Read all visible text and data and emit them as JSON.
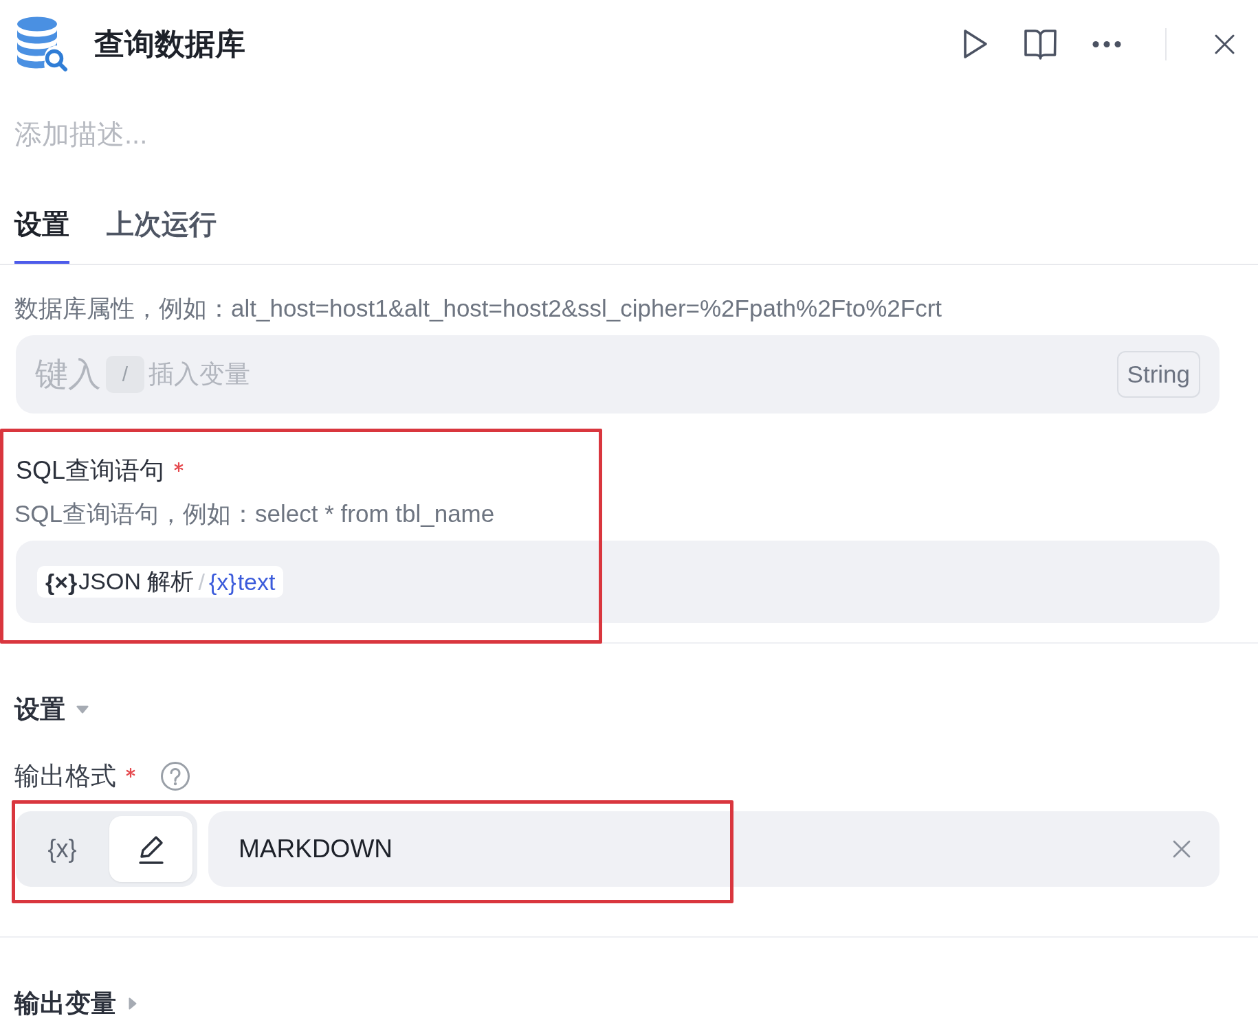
{
  "header": {
    "title": "查询数据库"
  },
  "description": {
    "placeholder": "添加描述..."
  },
  "tabs": [
    {
      "label": "设置",
      "selected": true
    },
    {
      "label": "上次运行",
      "selected": false
    }
  ],
  "fields": [
    {
      "kind": "text",
      "hint": "数据库属性，例如：alt_host=host1&alt_host=host2&ssl_cipher=%2Fpath%2Fto%2Fcrt",
      "input": {
        "placeholder": "键入",
        "shortcut_key": "/",
        "shortcut_hint": "插入变量",
        "type_badge": "String"
      }
    },
    {
      "kind": "variable",
      "label": "SQL查询语句",
      "required": true,
      "hint": "SQL查询语句，例如：select * from tbl_name",
      "annotated": true,
      "value_tag": {
        "node_icon": "{×}",
        "node": "JSON 解析",
        "separator": "/",
        "variable_icon": "{x}",
        "variable": "text"
      }
    }
  ],
  "settings": {
    "title": "设置",
    "expanded": true,
    "output_format": {
      "label": "输出格式",
      "required": true,
      "annotated": true,
      "modes": [
        {
          "kind": "variable",
          "label": "{x}",
          "selected": false
        },
        {
          "kind": "literal",
          "selected": true
        }
      ],
      "value": "MARKDOWN"
    }
  },
  "output_variables": {
    "title": "输出变量",
    "expanded": false
  }
}
